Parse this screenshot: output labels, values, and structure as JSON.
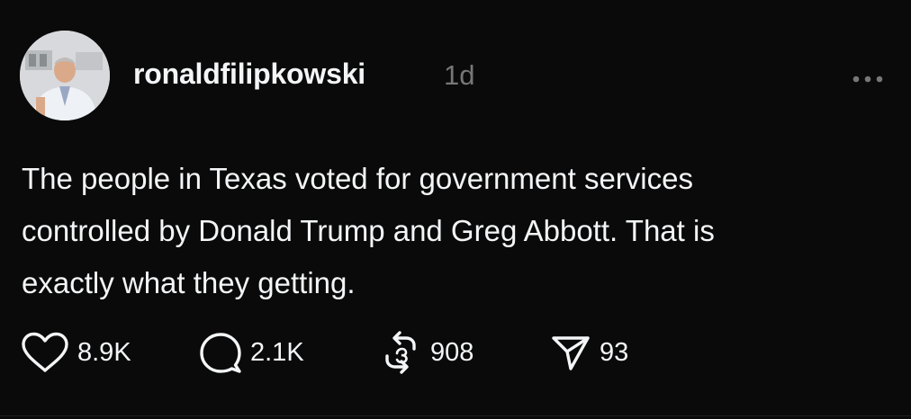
{
  "post": {
    "username": "ronaldfilipkowski",
    "time": "1d",
    "text": "The people in Texas voted for government services\ncontrolled by Donald Trump and Greg Abbott. That is\nexactly what they getting.",
    "actions": {
      "likes": "8.9K",
      "replies": "2.1K",
      "reposts": "908",
      "shares": "93"
    }
  },
  "icons": {
    "more": "more-horizontal-icon",
    "like": "heart-icon",
    "reply": "comment-bubble-icon",
    "repost": "repost-icon",
    "share": "send-icon"
  },
  "colors": {
    "background": "#0a0a0a",
    "text": "#f3f5f7",
    "muted": "#777777"
  }
}
